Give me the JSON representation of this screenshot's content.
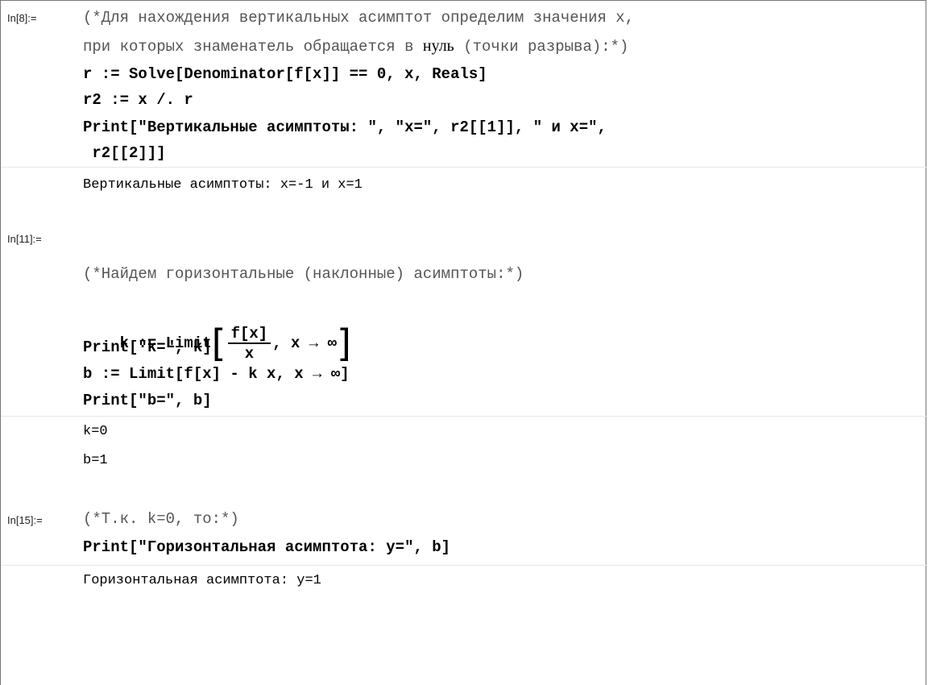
{
  "cells": {
    "c1": {
      "label": "In[8]:=",
      "comment_l1": "(*Для нахождения вертикальных асимптот определим значения x,",
      "comment_l2a": "при которых знаменатель обращается в ",
      "comment_l2_word": "нуль",
      "comment_l2b": " (точки разрыва):*)",
      "code_r": "r := Solve[Denominator[f[x]] == 0, x, Reals]",
      "code_r2": "r2 := x /. r",
      "code_print1": "Print[\"Вертикальные асимптоты: \", \"x=\", r2[[1]], \" и x=\",",
      "code_print1_cont": " r2[[2]]]",
      "output": "Вертикальные асимптоты: x=-1 и x=1"
    },
    "c2": {
      "label": "In[11]:=",
      "comment": "(*Найдем горизонтальные (наклонные) асимптоты:*)",
      "k_head": "k := Limit",
      "k_num": "f[x]",
      "k_den": "x",
      "k_tail": ", x → ∞",
      "print_k": "Print[\"k=\", k]",
      "b_def": "b := Limit[f[x] - k x, x → ∞]",
      "print_b": "Print[\"b=\", b]",
      "out_k": "k=0",
      "out_b": "b=1"
    },
    "c3": {
      "label": "In[15]:=",
      "comment": "(*Т.к. k=0, то:*)",
      "code": "Print[\"Горизонтальная асимптота: y=\", b]",
      "output": "Горизонтальная асимптота: y=1"
    }
  }
}
